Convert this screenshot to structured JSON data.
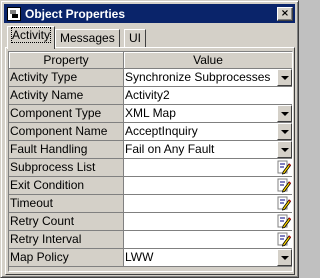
{
  "window": {
    "title": "Object Properties",
    "close_label": "×"
  },
  "tabs": [
    {
      "label": "Activity",
      "active": true
    },
    {
      "label": "Messages",
      "active": false
    },
    {
      "label": "UI",
      "active": false
    }
  ],
  "grid": {
    "headers": {
      "property": "Property",
      "value": "Value"
    },
    "rows": [
      {
        "property": "Activity Type",
        "value": "Synchronize Subprocesses",
        "control": "dropdown"
      },
      {
        "property": "Activity Name",
        "value": "Activity2",
        "control": "text"
      },
      {
        "property": "Component Type",
        "value": "XML Map",
        "control": "dropdown"
      },
      {
        "property": "Component Name",
        "value": "AcceptInquiry",
        "control": "dropdown"
      },
      {
        "property": "Fault Handling",
        "value": "Fail on Any Fault",
        "control": "dropdown"
      },
      {
        "property": "Subprocess List",
        "value": "",
        "control": "editor"
      },
      {
        "property": "Exit Condition",
        "value": "",
        "control": "editor"
      },
      {
        "property": "Timeout",
        "value": "",
        "control": "editor"
      },
      {
        "property": "Retry Count",
        "value": "",
        "control": "editor"
      },
      {
        "property": "Retry Interval",
        "value": "",
        "control": "editor"
      },
      {
        "property": "Map Policy",
        "value": "LWW",
        "control": "dropdown"
      }
    ]
  },
  "icons": {
    "dropdown": "chevron-down-icon",
    "editor": "edit-pencil-icon",
    "app": "object-properties-icon"
  },
  "colors": {
    "titlebar": "#0a246a",
    "face": "#d4d0c8",
    "value_bg": "#ffffff"
  }
}
